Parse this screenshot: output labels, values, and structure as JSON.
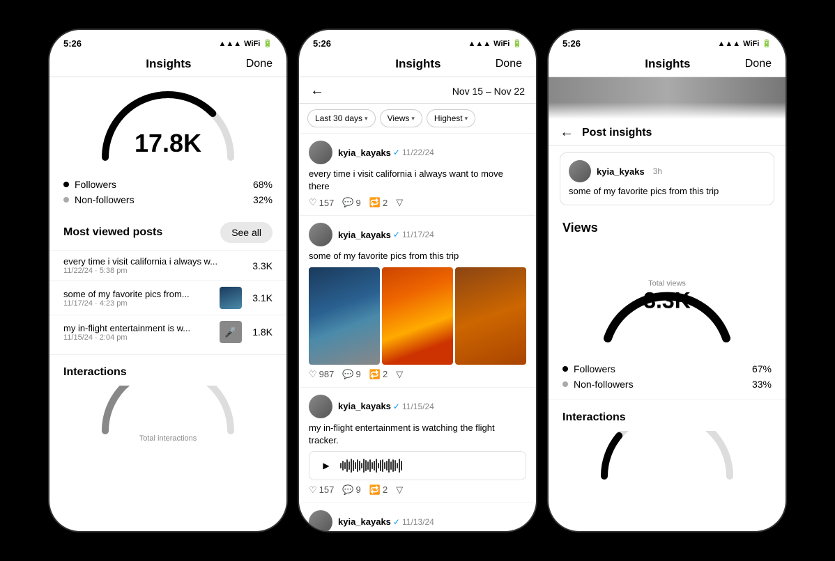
{
  "phone1": {
    "status_time": "5:26",
    "nav_title": "Insights",
    "nav_done": "Done",
    "total_views": "17.8K",
    "legend": [
      {
        "label": "Followers",
        "pct": "68%",
        "dot": "dark"
      },
      {
        "label": "Non-followers",
        "pct": "32%",
        "dot": "gray"
      }
    ],
    "most_viewed_title": "Most viewed posts",
    "see_all": "See all",
    "posts": [
      {
        "title": "every time i visit california i always w...",
        "date": "11/22/24 · 5:38 pm",
        "count": "3.3K",
        "has_thumb": false
      },
      {
        "title": "some of my favorite pics from...",
        "date": "11/17/24 · 4:23 pm",
        "count": "3.1K",
        "has_thumb": true
      },
      {
        "title": "my in-flight entertainment is w...",
        "date": "11/15/24 · 2:04 pm",
        "count": "1.8K",
        "has_thumb": true
      }
    ],
    "interactions_title": "Interactions"
  },
  "phone2": {
    "status_time": "5:26",
    "nav_title": "Insights",
    "nav_done": "Done",
    "date_range": "Nov 15 – Nov 22",
    "filters": [
      {
        "label": "Last 30 days"
      },
      {
        "label": "Views"
      },
      {
        "label": "Highest"
      }
    ],
    "posts": [
      {
        "username": "kyia_kayaks",
        "verified": true,
        "date": "11/22/24",
        "caption": "every time i visit california i always want to move there",
        "likes": "157",
        "comments": "9",
        "reposts": "2",
        "type": "text"
      },
      {
        "username": "kyia_kayaks",
        "verified": true,
        "date": "11/17/24",
        "caption": "some of my favorite pics from this trip",
        "likes": "987",
        "comments": "9",
        "reposts": "2",
        "type": "images"
      },
      {
        "username": "kyia_kayaks",
        "verified": true,
        "date": "11/15/24",
        "caption": "my in-flight entertainment is watching the flight tracker.",
        "likes": "157",
        "comments": "9",
        "reposts": "2",
        "type": "audio"
      },
      {
        "username": "kyia_kayaks",
        "verified": true,
        "date": "11/13/24",
        "caption": "",
        "likes": "",
        "comments": "",
        "reposts": "",
        "type": "text"
      }
    ]
  },
  "phone3": {
    "status_time": "5:26",
    "nav_title": "Insights",
    "nav_done": "Done",
    "sub_title": "Post insights",
    "post_username": "kyia_kyaks",
    "post_time": "3h",
    "post_caption": "some of my favorite pics from this trip",
    "views_title": "Views",
    "total_views_label": "Total views",
    "total_views": "3.3K",
    "legend": [
      {
        "label": "Followers",
        "pct": "67%",
        "dot": "dark"
      },
      {
        "label": "Non-followers",
        "pct": "33%",
        "dot": "gray"
      }
    ],
    "interactions_title": "Interactions"
  }
}
